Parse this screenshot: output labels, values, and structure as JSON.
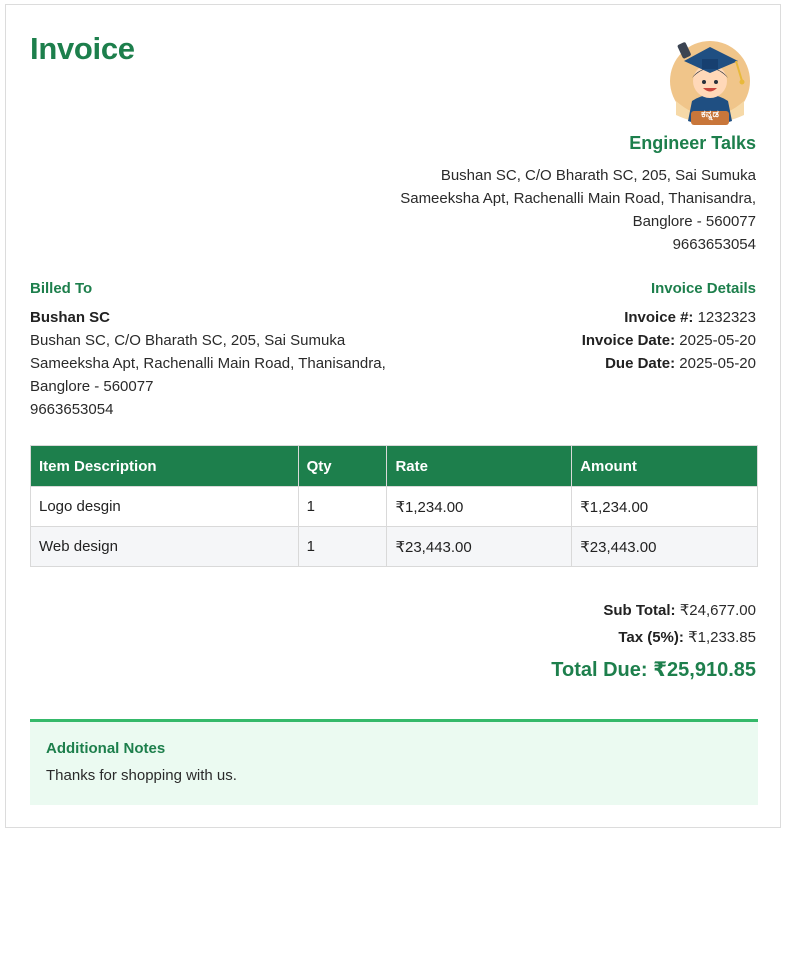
{
  "invoice_title": "Invoice",
  "logo": {
    "icon": "graduate-mascot-logo",
    "text": "ಕನ್ನಡ"
  },
  "company": {
    "name": "Engineer Talks",
    "address_lines": [
      "Bushan SC, C/O Bharath SC, 205, Sai Sumuka",
      "Sameeksha Apt, Rachenalli Main Road, Thanisandra,",
      "Banglore - 560077"
    ],
    "phone": "9663653054"
  },
  "billed_to": {
    "heading": "Billed To",
    "name": "Bushan SC",
    "address_lines": [
      "Bushan SC, C/O Bharath SC, 205, Sai Sumuka",
      "Sameeksha Apt, Rachenalli Main Road, Thanisandra,",
      "Banglore - 560077"
    ],
    "phone": "9663653054"
  },
  "invoice_details": {
    "heading": "Invoice Details",
    "number_label": "Invoice #:",
    "number": "1232323",
    "date_label": "Invoice Date:",
    "date": "2025-05-20",
    "due_label": "Due Date:",
    "due": "2025-05-20"
  },
  "items_table": {
    "headers": [
      "Item Description",
      "Qty",
      "Rate",
      "Amount"
    ],
    "rows": [
      [
        "Logo desgin",
        "1",
        "₹1,234.00",
        "₹1,234.00"
      ],
      [
        "Web design",
        "1",
        "₹23,443.00",
        "₹23,443.00"
      ]
    ]
  },
  "totals": {
    "subtotal_label": "Sub Total:",
    "subtotal": "₹24,677.00",
    "tax_label": "Tax (5%):",
    "tax": "₹1,233.85",
    "total_label": "Total Due:",
    "total": "₹25,910.85"
  },
  "notes": {
    "heading": "Additional Notes",
    "text": "Thanks for shopping with us."
  },
  "colors": {
    "accent": "#1d7f4c",
    "notes_bg": "#ebfaf1",
    "notes_border": "#35b96a"
  }
}
